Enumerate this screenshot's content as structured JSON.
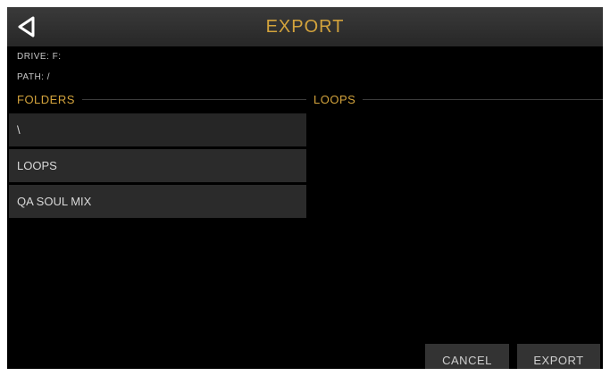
{
  "header": {
    "title": "EXPORT",
    "back_icon": "back-triangle-icon"
  },
  "info": {
    "drive": "DRIVE: F:",
    "path": "PATH: /"
  },
  "folders": {
    "label": "FOLDERS",
    "items": [
      "\\",
      "LOOPS",
      "QA SOUL MIX"
    ]
  },
  "loops": {
    "label": "LOOPS"
  },
  "buttons": {
    "cancel": "CANCEL",
    "export": "EXPORT"
  },
  "colors": {
    "accent": "#d3a33c",
    "background": "#000000",
    "list_item": "#2b2b2b",
    "button": "#333333"
  }
}
